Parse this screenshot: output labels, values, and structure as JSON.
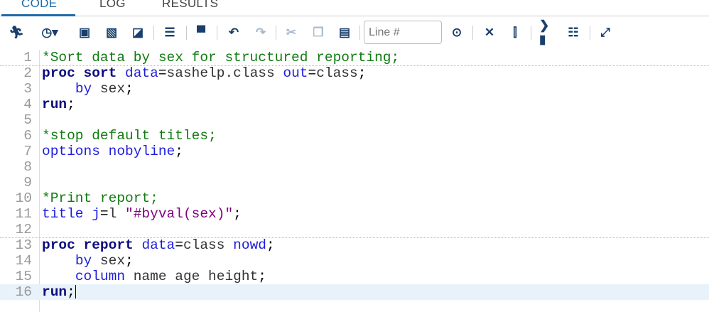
{
  "tabs": [
    {
      "label": "CODE",
      "active": true
    },
    {
      "label": "LOG"
    },
    {
      "label": "RESULTS"
    }
  ],
  "toolbar": {
    "line_placeholder": "Line #",
    "icons": [
      "run-icon",
      "history-icon",
      "save-icon",
      "save-as-icon",
      "download-icon",
      "format-code-icon",
      "print-icon",
      "undo-icon",
      "redo-icon",
      "cut-icon",
      "copy-icon",
      "paste-icon",
      "go-to-line-icon",
      "clear-icon",
      "find-icon",
      "submit-selected-icon",
      "snippet-icon",
      "maximize-icon"
    ]
  },
  "editor": {
    "current_line": 16,
    "lines": [
      {
        "n": "1",
        "sep": true,
        "tokens": [
          [
            "comment",
            "*Sort data by sex for structured reporting;"
          ]
        ]
      },
      {
        "n": "2",
        "tokens": [
          [
            "kw",
            "proc sort"
          ],
          [
            "plain",
            " "
          ],
          [
            "opt",
            "data"
          ],
          [
            "punct",
            "="
          ],
          [
            "plain",
            "sashelp.class "
          ],
          [
            "opt",
            "out"
          ],
          [
            "punct",
            "="
          ],
          [
            "plain",
            "class"
          ],
          [
            "punct",
            ";"
          ]
        ]
      },
      {
        "n": "3",
        "tokens": [
          [
            "plain",
            "    "
          ],
          [
            "opt",
            "by"
          ],
          [
            "plain",
            " sex"
          ],
          [
            "punct",
            ";"
          ]
        ]
      },
      {
        "n": "4",
        "tokens": [
          [
            "kw",
            "run"
          ],
          [
            "punct",
            ";"
          ]
        ]
      },
      {
        "n": "5",
        "tokens": []
      },
      {
        "n": "6",
        "tokens": [
          [
            "comment",
            "*stop default titles;"
          ]
        ]
      },
      {
        "n": "7",
        "tokens": [
          [
            "opt",
            "options"
          ],
          [
            "plain",
            " "
          ],
          [
            "opt",
            "nobyline"
          ],
          [
            "punct",
            ";"
          ]
        ]
      },
      {
        "n": "8",
        "tokens": []
      },
      {
        "n": "9",
        "tokens": []
      },
      {
        "n": "10",
        "tokens": [
          [
            "comment",
            "*Print report;"
          ]
        ]
      },
      {
        "n": "11",
        "tokens": [
          [
            "opt",
            "title"
          ],
          [
            "plain",
            " "
          ],
          [
            "opt",
            "j"
          ],
          [
            "punct",
            "="
          ],
          [
            "plain",
            "l "
          ],
          [
            "str",
            "\"#byval(sex)\""
          ],
          [
            "punct",
            ";"
          ]
        ]
      },
      {
        "n": "12",
        "sep": true,
        "tokens": []
      },
      {
        "n": "13",
        "tokens": [
          [
            "kw",
            "proc report"
          ],
          [
            "plain",
            " "
          ],
          [
            "opt",
            "data"
          ],
          [
            "punct",
            "="
          ],
          [
            "plain",
            "class "
          ],
          [
            "opt",
            "nowd"
          ],
          [
            "punct",
            ";"
          ]
        ]
      },
      {
        "n": "14",
        "tokens": [
          [
            "plain",
            "    "
          ],
          [
            "opt",
            "by"
          ],
          [
            "plain",
            " sex"
          ],
          [
            "punct",
            ";"
          ]
        ]
      },
      {
        "n": "15",
        "tokens": [
          [
            "plain",
            "    "
          ],
          [
            "opt",
            "column"
          ],
          [
            "plain",
            " name age height"
          ],
          [
            "punct",
            ";"
          ]
        ]
      },
      {
        "n": "16",
        "tokens": [
          [
            "kw",
            "run"
          ],
          [
            "punct",
            ";"
          ]
        ]
      }
    ]
  }
}
